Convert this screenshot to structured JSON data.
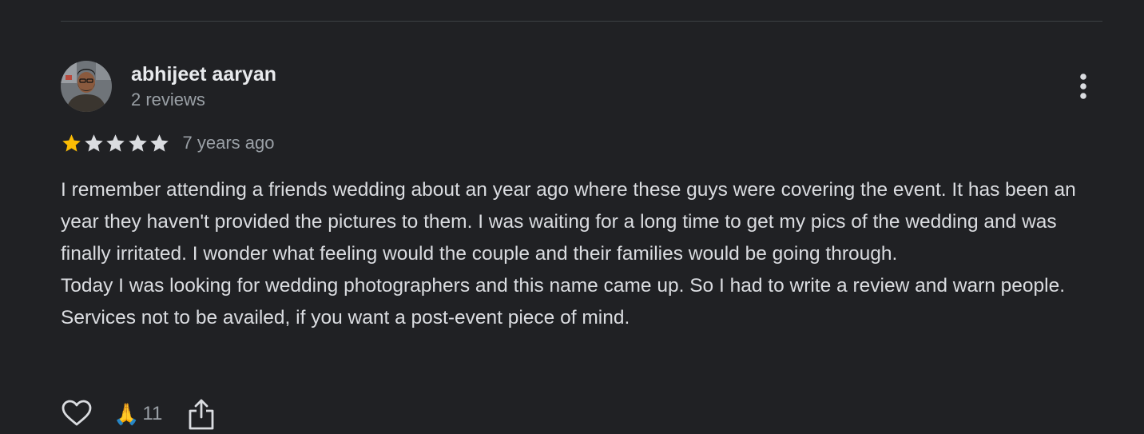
{
  "review": {
    "author": {
      "name": "abhijeet aaryan",
      "review_count": "2 reviews"
    },
    "rating": 1,
    "max_rating": 5,
    "timestamp": "7 years ago",
    "paragraphs": [
      "I remember attending a friends wedding about an year ago where these guys were covering the event. It has been an year they haven't provided the pictures to them. I was waiting for a long time to get my pics of the wedding and was finally irritated. I wonder what feeling would the couple and their families would be going through.",
      "Today I was looking for wedding photographers and this name came up. So I had to write a review and warn people. Services not to be availed, if you want a post-event piece of mind."
    ],
    "reactions": {
      "emoji": "🙏",
      "count": "11"
    }
  },
  "icons": {
    "more": "more-vert-icon",
    "like": "heart-icon",
    "share": "share-icon",
    "star": "star-icon"
  },
  "colors": {
    "background": "#202124",
    "star_filled": "#fbbc04",
    "star_empty": "#dadce0",
    "primary_text": "#e8eaed",
    "secondary_text": "#9aa0a6",
    "divider": "#3c4043"
  }
}
